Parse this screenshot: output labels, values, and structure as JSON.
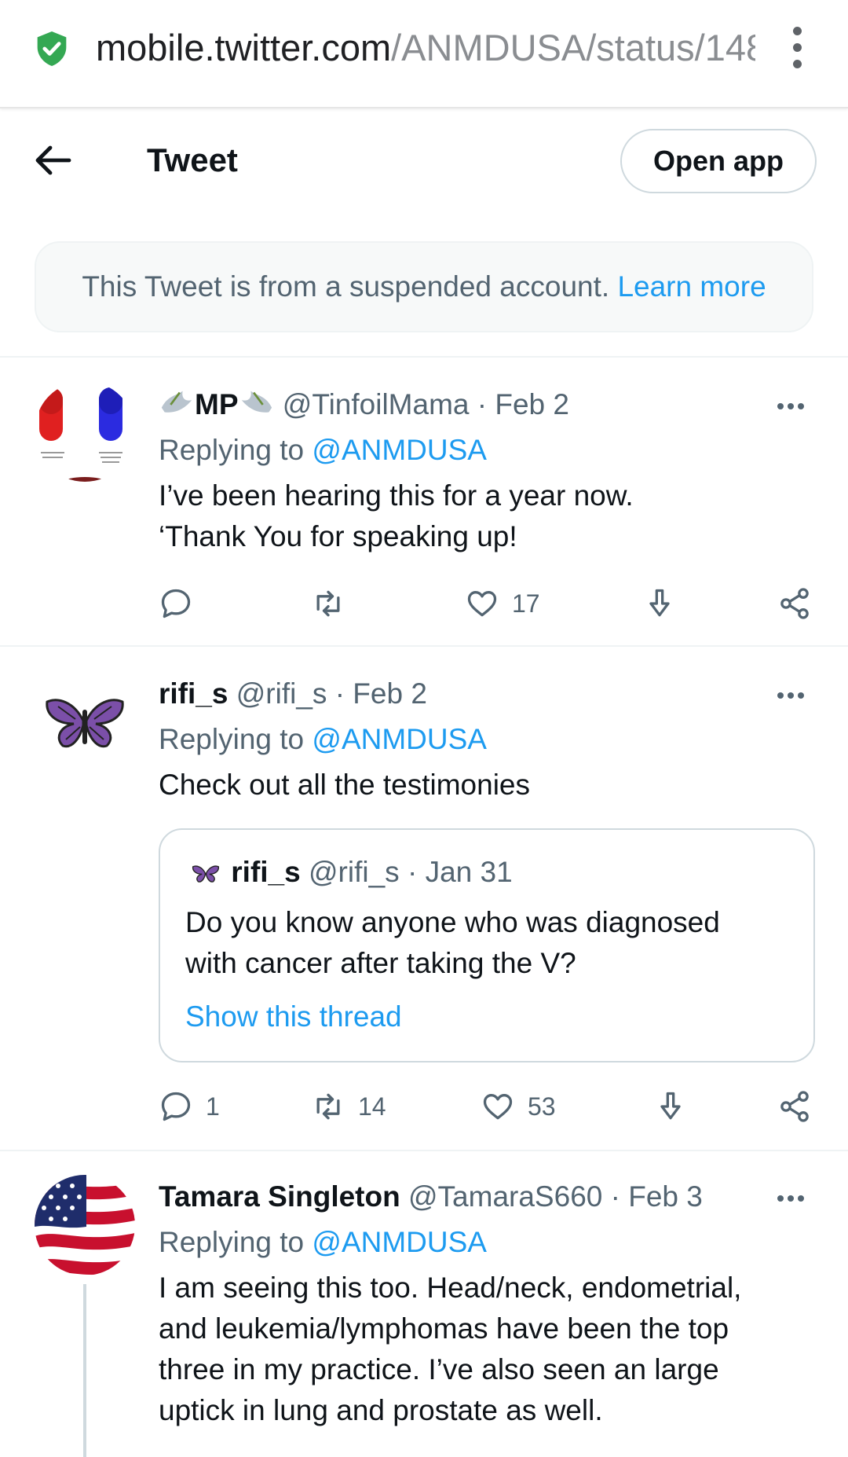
{
  "browser": {
    "url_host": "mobile.twitter.com",
    "url_path": "/ANMDUSA/status/148",
    "secure_icon": "shield-check-icon",
    "menu_icon": "kebab-menu-icon"
  },
  "header": {
    "title": "Tweet",
    "open_app_label": "Open app",
    "back_icon": "arrow-left-icon"
  },
  "notice": {
    "text": "This Tweet is from a suspended account.",
    "link": "Learn more"
  },
  "colors": {
    "accent": "#1d9bf0",
    "text": "#0f1419",
    "muted": "#536471",
    "border": "#cfd9de"
  },
  "tweets": [
    {
      "name": "MP",
      "name_decoration": "dove-emoji",
      "handle": "@TinfoilMama",
      "date": "· Feb 2",
      "replying_label": "Replying to",
      "replying_to": "@ANMDUSA",
      "lines": [
        "I’ve been hearing this for a year now.",
        "‘Thank You for speaking up!"
      ],
      "avatar": "red-blue-pills-image",
      "actions": {
        "replies": "",
        "retweets": "",
        "likes": "17"
      }
    },
    {
      "name": "rifi_s",
      "handle": "@rifi_s",
      "date": "· Feb 2",
      "replying_label": "Replying to",
      "replying_to": "@ANMDUSA",
      "lines": [
        "Check out all the testimonies"
      ],
      "avatar": "purple-butterfly-image",
      "quote": {
        "name": "rifi_s",
        "handle": "@rifi_s",
        "date": "· Jan 31",
        "lines": [
          "Do you know anyone who was diagnosed",
          "with cancer after taking the V?"
        ],
        "link": "Show this thread"
      },
      "actions": {
        "replies": "1",
        "retweets": "14",
        "likes": "53"
      }
    },
    {
      "name": "Tamara Singleton",
      "handle": "@TamaraS660",
      "date": "· Feb 3",
      "replying_label": "Replying to",
      "replying_to": "@ANMDUSA",
      "lines": [
        "I am seeing this too. Head/neck, endometrial,",
        "and leukemia/lymphomas have been the top",
        "three in my practice. I’ve also seen an large",
        "uptick in lung and prostate as well."
      ],
      "avatar": "american-flag-image"
    }
  ]
}
